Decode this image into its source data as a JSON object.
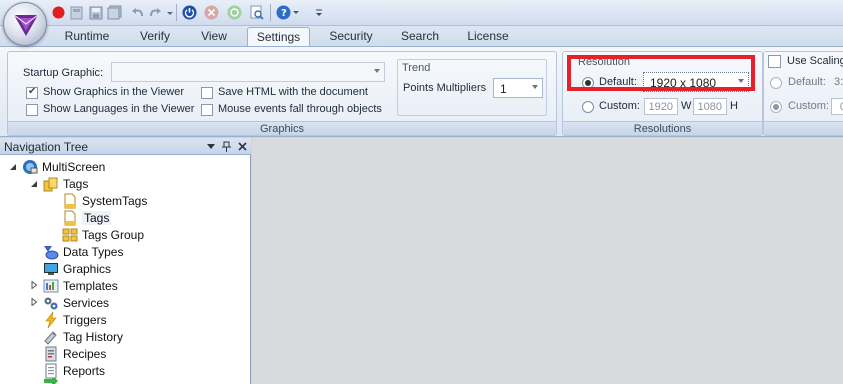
{
  "ribbon_tabs": [
    "Runtime",
    "Verify",
    "View",
    "Settings",
    "Security",
    "Search",
    "License"
  ],
  "active_tab": "Settings",
  "graphics_group": {
    "caption": "Graphics",
    "startup_graphic_label": "Startup Graphic:",
    "startup_graphic_value": "",
    "show_graphics_viewer": "Show Graphics in the Viewer",
    "show_languages_viewer": "Show Languages in the Viewer",
    "save_html": "Save HTML with the document",
    "mouse_events": "Mouse events fall through objects",
    "trend_title": "Trend",
    "points_multipliers_label": "Points Multipliers",
    "points_multipliers_value": "1"
  },
  "resolutions_group": {
    "caption": "Resolutions",
    "resolution_title": "Resolution",
    "default_label": "Default:",
    "default_value": "1920 x 1080",
    "custom_label": "Custom:",
    "custom_width": "1920",
    "custom_width_unit": "W",
    "custom_height": "1080",
    "custom_height_unit": "H"
  },
  "scaling_group": {
    "use_scaling": "Use Scaling",
    "default_label": "Default:",
    "default_value": "3:",
    "custom_label": "Custom:",
    "custom_value": "0"
  },
  "nav_tree": {
    "title": "Navigation Tree",
    "items": [
      {
        "label": "MultiScreen",
        "icon": "project-icon"
      },
      {
        "label": "Tags",
        "icon": "tags-folder-icon"
      },
      {
        "label": "SystemTags",
        "icon": "document-icon"
      },
      {
        "label": "Tags",
        "icon": "document-icon"
      },
      {
        "label": "Tags Group",
        "icon": "tags-group-icon"
      },
      {
        "label": "Data Types",
        "icon": "data-types-icon"
      },
      {
        "label": "Graphics",
        "icon": "monitor-icon"
      },
      {
        "label": "Templates",
        "icon": "templates-icon"
      },
      {
        "label": "Services",
        "icon": "gears-icon"
      },
      {
        "label": "Triggers",
        "icon": "lightning-icon"
      },
      {
        "label": "Tag History",
        "icon": "tag-history-icon"
      },
      {
        "label": "Recipes",
        "icon": "recipes-icon"
      },
      {
        "label": "Reports",
        "icon": "reports-icon"
      }
    ]
  },
  "colors": {
    "highlight_border": "#e8202a",
    "ribbon_bg": "#dfe7f2",
    "workspace_bg": "#d9dadb"
  }
}
